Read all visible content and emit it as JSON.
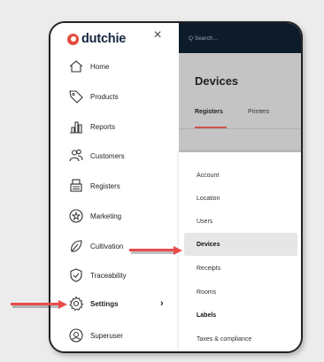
{
  "brand": {
    "name": "dutchie"
  },
  "close_icon": "×",
  "search": {
    "placeholder": "Q Search..."
  },
  "nav": {
    "items": [
      {
        "label": "Home",
        "icon": "home-icon"
      },
      {
        "label": "Products",
        "icon": "tag-icon"
      },
      {
        "label": "Reports",
        "icon": "bar-chart-icon"
      },
      {
        "label": "Customers",
        "icon": "users-icon"
      },
      {
        "label": "Registers",
        "icon": "register-icon"
      },
      {
        "label": "Marketing",
        "icon": "marketing-icon"
      },
      {
        "label": "Cultivation",
        "icon": "leaf-icon"
      },
      {
        "label": "Traceability",
        "icon": "shield-check-icon"
      },
      {
        "label": "Settings",
        "icon": "gear-icon",
        "active": true,
        "chevron": "›"
      },
      {
        "label": "Superuser",
        "icon": "superuser-icon"
      }
    ]
  },
  "page": {
    "title": "Devices",
    "tabs": [
      {
        "label": "Registers",
        "active": true
      },
      {
        "label": "Printers"
      }
    ]
  },
  "settings_menu": {
    "items": [
      {
        "label": "Account"
      },
      {
        "label": "Location"
      },
      {
        "label": "Users"
      },
      {
        "label": "Devices",
        "highlight": true
      },
      {
        "label": "Receipts"
      },
      {
        "label": "Rooms"
      },
      {
        "label": "Labels",
        "bold": true
      },
      {
        "label": "Taxes & compliance"
      }
    ]
  },
  "colors": {
    "brand_red": "#e24b3d",
    "search_bar": "#0d1b2a",
    "panel_gray": "#c4c4c4",
    "arrow_red": "#e94c4c",
    "tab_underline": "#c9554a"
  }
}
